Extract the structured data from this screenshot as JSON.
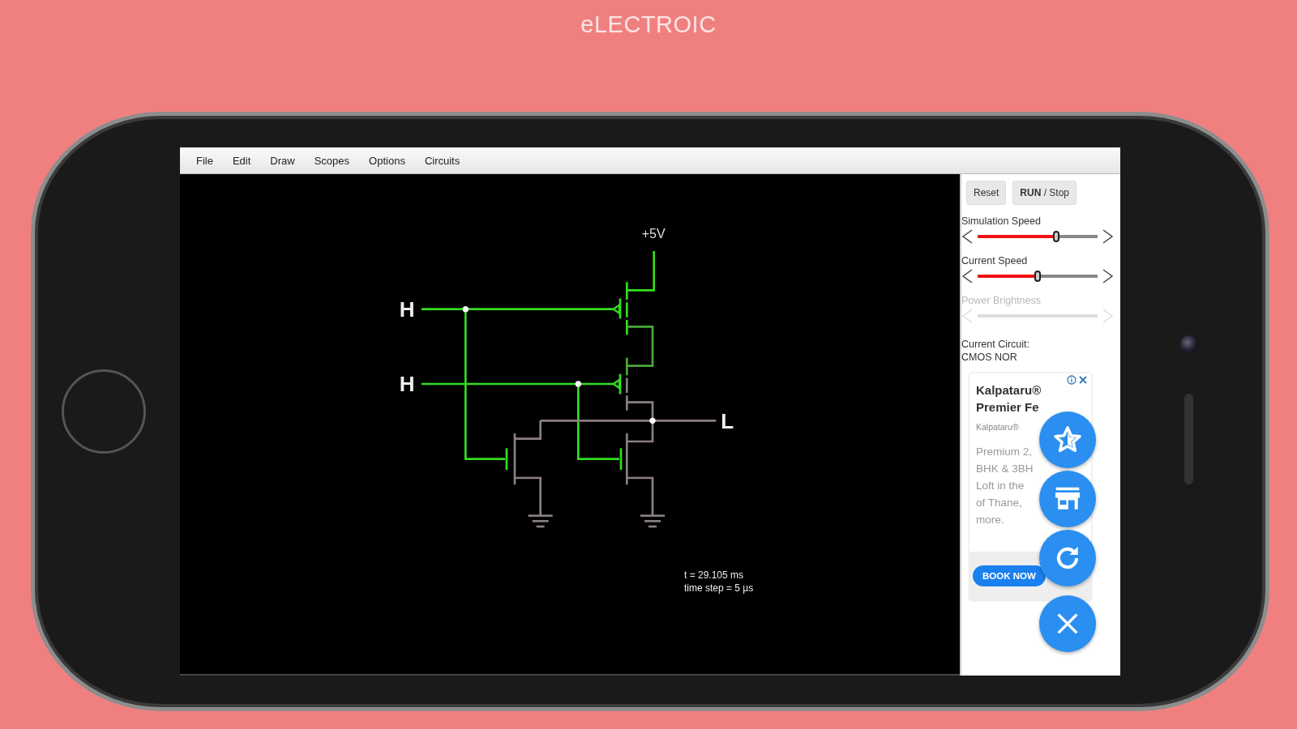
{
  "title": "eLECTROIC",
  "menu": [
    "File",
    "Edit",
    "Draw",
    "Scopes",
    "Options",
    "Circuits"
  ],
  "circuit": {
    "supply_label": "+5V",
    "inputs": [
      {
        "label": "H"
      },
      {
        "label": "H"
      }
    ],
    "output": {
      "label": "L"
    }
  },
  "status": [
    "t = 29.105 ms",
    "time step = 5 µs"
  ],
  "panel": {
    "buttons": [
      {
        "label": "Reset"
      },
      {
        "label": "**RUN** / Stop"
      }
    ],
    "sliders": [
      {
        "label": "Simulation Speed",
        "level": 0.66,
        "disabled": false
      },
      {
        "label": "Current Speed",
        "level": 0.51,
        "disabled": false
      },
      {
        "label": "Power Brightness",
        "disabled": true
      }
    ],
    "circuit_caption": "Current Circuit:",
    "circuit_name": "CMOS NOR"
  },
  "ad": {
    "title_lines": [
      "Kalpataru®",
      "Premier Fe"
    ],
    "advertiser": "Kalpataru®",
    "body_lines": [
      "Premium 2,",
      "BHK & 3BH",
      "Loft in the",
      "of Thane,",
      "more."
    ],
    "button": "BOOK NOW"
  },
  "fabs": [
    {
      "kind": "star"
    },
    {
      "kind": "store"
    },
    {
      "kind": "refresh"
    },
    {
      "kind": "close"
    }
  ]
}
